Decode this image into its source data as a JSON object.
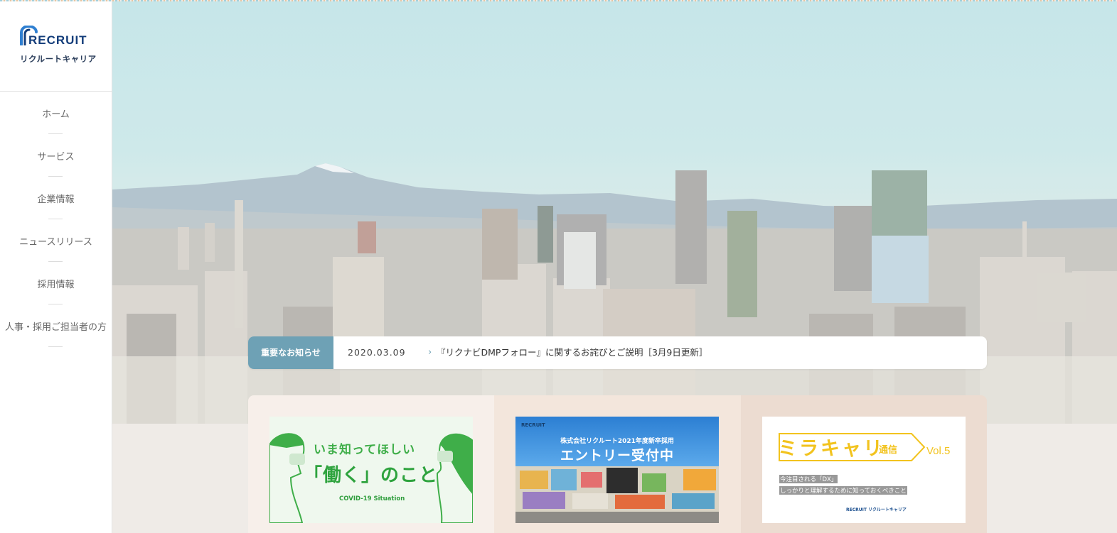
{
  "sidebar": {
    "logo_en": "RECRUIT",
    "logo_ja": "リクルートキャリア",
    "nav": [
      {
        "label": "ホーム"
      },
      {
        "label": "サービス"
      },
      {
        "label": "企業情報"
      },
      {
        "label": "ニュースリリース"
      },
      {
        "label": "採用情報"
      },
      {
        "label": "人事・採用ご担当者の方"
      }
    ]
  },
  "notice": {
    "badge": "重要なお知らせ",
    "date": "2020.03.09",
    "title": "『リクナビDMPフォロー』に関するお詫びとご説明［3月9日更新］"
  },
  "cards": {
    "covid": {
      "line1": "いま知ってほしい",
      "line2": "「働く」のこと",
      "line3": "COVID-19 Situation"
    },
    "entry": {
      "logo": "RECRUIT",
      "line1": "株式会社リクルート2021年度新卒採用",
      "line2": "エントリー受付中"
    },
    "miracari": {
      "title": "ミラキャリ",
      "subtitle": "通信",
      "vol": "Vol.5",
      "line1": "今注目される「DX」",
      "line2": "しっかりと理解するために知っておくべきこと",
      "footer": "RECRUIT リクルートキャリア"
    }
  },
  "colors": {
    "brand_navy": "#133d7a",
    "notice_badge": "#6ea1b5",
    "covid_green": "#3fae49",
    "miracari_yellow": "#f2c31e"
  }
}
